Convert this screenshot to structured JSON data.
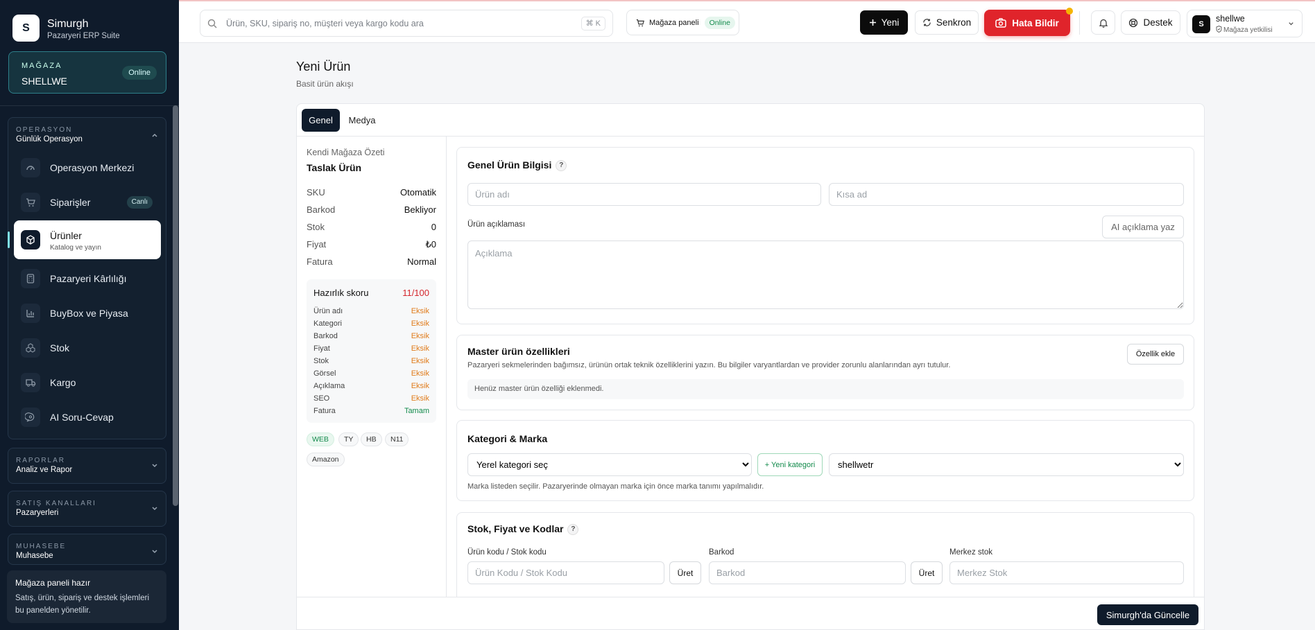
{
  "sidebar": {
    "logo_letter": "S",
    "brand_name": "Simurgh",
    "brand_sub": "Pazaryeri ERP Suite",
    "store_label": "MAĞAZA",
    "store_name": "SHELLWE",
    "store_status": "Online",
    "groups": [
      {
        "label": "OPERASYON",
        "sub": "Günlük Operasyon",
        "expanded": true
      },
      {
        "label": "RAPORLAR",
        "sub": "Analiz ve Rapor",
        "expanded": false
      },
      {
        "label": "SATIŞ KANALLARI",
        "sub": "Pazaryerleri",
        "expanded": false
      },
      {
        "label": "MUHASEBE",
        "sub": "Muhasebe",
        "expanded": false
      }
    ],
    "items": [
      {
        "label": "Operasyon Merkezi",
        "icon": "gauge-icon"
      },
      {
        "label": "Siparişler",
        "icon": "cart-icon",
        "badge": "Canlı"
      },
      {
        "label": "Ürünler",
        "icon": "package-icon",
        "sub": "Katalog ve yayın",
        "active": true
      },
      {
        "label": "Pazaryeri Kârlılığı",
        "icon": "calculator-icon"
      },
      {
        "label": "BuyBox ve Piyasa",
        "icon": "bar-chart-icon"
      },
      {
        "label": "Stok",
        "icon": "boxes-icon"
      },
      {
        "label": "Kargo",
        "icon": "truck-icon"
      },
      {
        "label": "AI Soru-Cevap",
        "icon": "chat-icon"
      }
    ],
    "footer_title": "Mağaza paneli hazır",
    "footer_text": "Satış, ürün, sipariş ve destek işlemleri bu panelden yönetilir."
  },
  "topbar": {
    "search_placeholder": "Ürün, SKU, sipariş no, müşteri veya kargo kodu ara",
    "shortcut": "⌘ K",
    "store_panel_label": "Mağaza paneli",
    "store_panel_status": "Online",
    "new_label": "Yeni",
    "sync_label": "Senkron",
    "bug_label": "Hata Bildir",
    "help_label": "Destek",
    "user_initial": "S",
    "user_name": "shellwe",
    "user_role": "Mağaza yetkilisi"
  },
  "page": {
    "title": "Yeni Ürün",
    "subtitle": "Basit ürün akışı",
    "tabs": [
      "Genel",
      "Medya"
    ],
    "active_tab": "Genel"
  },
  "summary": {
    "title": "Kendi Mağaza Özeti",
    "product_name": "Taslak Ürün",
    "fields": [
      {
        "k": "SKU",
        "v": "Otomatik"
      },
      {
        "k": "Barkod",
        "v": "Bekliyor"
      },
      {
        "k": "Stok",
        "v": "0"
      },
      {
        "k": "Fiyat",
        "v": "₺0"
      },
      {
        "k": "Fatura",
        "v": "Normal"
      }
    ],
    "readiness_label": "Hazırlık skoru",
    "readiness_score": "11/100",
    "checks": [
      {
        "k": "Ürün adı",
        "v": "Eksik",
        "ok": false
      },
      {
        "k": "Kategori",
        "v": "Eksik",
        "ok": false
      },
      {
        "k": "Barkod",
        "v": "Eksik",
        "ok": false
      },
      {
        "k": "Fiyat",
        "v": "Eksik",
        "ok": false
      },
      {
        "k": "Stok",
        "v": "Eksik",
        "ok": false
      },
      {
        "k": "Görsel",
        "v": "Eksik",
        "ok": false
      },
      {
        "k": "Açıklama",
        "v": "Eksik",
        "ok": false
      },
      {
        "k": "SEO",
        "v": "Eksik",
        "ok": false
      },
      {
        "k": "Fatura",
        "v": "Tamam",
        "ok": true
      }
    ],
    "marketplaces": [
      "WEB",
      "TY",
      "HB",
      "N11",
      "Amazon"
    ]
  },
  "general": {
    "title": "Genel Ürün Bilgisi",
    "name_placeholder": "Ürün adı",
    "short_placeholder": "Kısa ad",
    "desc_label": "Ürün açıklaması",
    "ai_button": "AI açıklama yaz",
    "desc_placeholder": "Açıklama"
  },
  "master": {
    "title": "Master ürün özellikleri",
    "desc": "Pazaryeri sekmelerinden bağımsız, ürünün ortak teknik özelliklerini yazın. Bu bilgiler varyantlardan ve provider zorunlu alanlarından ayrı tutulur.",
    "add_label": "Özellik ekle",
    "empty": "Henüz master ürün özelliği eklenmedi."
  },
  "category": {
    "title": "Kategori & Marka",
    "category_value": "Yerel kategori seç",
    "new_category": "+ Yeni kategori",
    "brand_value": "shellwetr",
    "note": "Marka listeden seçilir. Pazaryerinde olmayan marka için önce marka tanımı yapılmalıdır."
  },
  "stock": {
    "title": "Stok, Fiyat ve Kodlar",
    "code_label": "Ürün kodu / Stok kodu",
    "code_placeholder": "Ürün Kodu / Stok Kodu",
    "generate": "Üret",
    "barcode_label": "Barkod",
    "barcode_placeholder": "Barkod",
    "center_label": "Merkez stok",
    "center_placeholder": "Merkez Stok"
  },
  "footer": {
    "save_label": "Simurgh'da Güncelle"
  }
}
